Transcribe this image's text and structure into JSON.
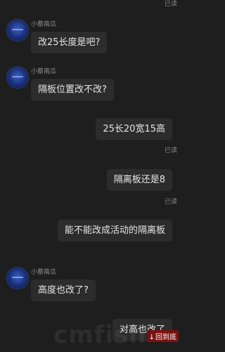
{
  "status": {
    "read_label": "已读"
  },
  "sender_name": "小蔡南瓜",
  "messages": [
    {
      "text": "改25长度是吧?"
    },
    {
      "text": "隔板位置改不改?"
    },
    {
      "text": "25长20宽15高"
    },
    {
      "text": "隔离板还是8"
    },
    {
      "text": "能不能改成活动的隔离板"
    },
    {
      "text": "高度也改了?"
    },
    {
      "text": "对高也改了"
    }
  ],
  "watermark": "cmfish",
  "to_bottom_button": {
    "label": "回到底",
    "icon": "arrow-down-icon"
  }
}
